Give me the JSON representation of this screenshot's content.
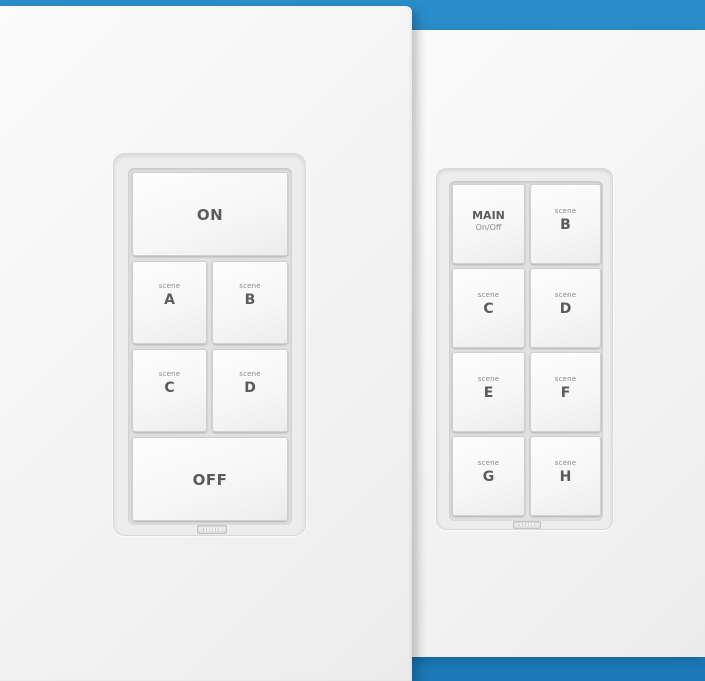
{
  "left_keypad": {
    "on_label": "ON",
    "off_label": "OFF",
    "scene_buttons": [
      {
        "caption": "scene",
        "letter": "A"
      },
      {
        "caption": "scene",
        "letter": "B"
      },
      {
        "caption": "scene",
        "letter": "C"
      },
      {
        "caption": "scene",
        "letter": "D"
      }
    ]
  },
  "right_keypad": {
    "main_label": "MAIN",
    "main_sub_label": "On/Off",
    "scene_buttons": [
      {
        "caption": "scene",
        "letter": "B"
      },
      {
        "caption": "scene",
        "letter": "C"
      },
      {
        "caption": "scene",
        "letter": "D"
      },
      {
        "caption": "scene",
        "letter": "E"
      },
      {
        "caption": "scene",
        "letter": "F"
      },
      {
        "caption": "scene",
        "letter": "G"
      },
      {
        "caption": "scene",
        "letter": "H"
      }
    ]
  },
  "colors": {
    "background": "#2a8ecb",
    "plate": "#f5f5f5",
    "button_text": "#5b5b5b"
  }
}
